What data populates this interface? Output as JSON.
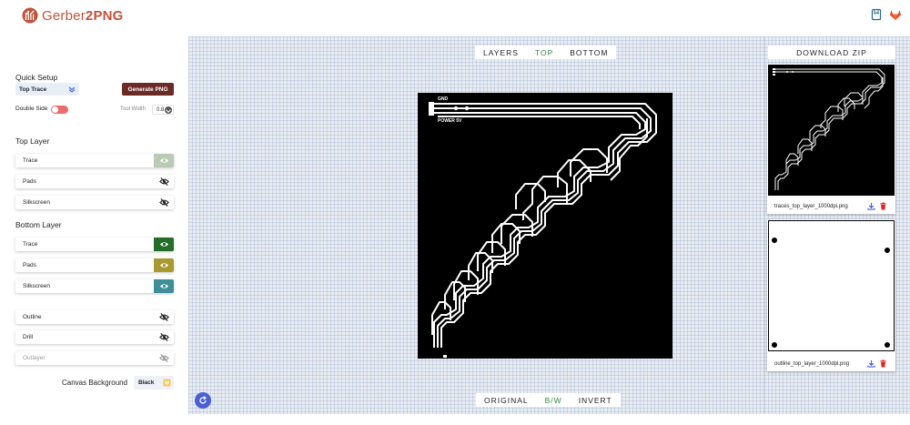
{
  "header": {
    "brand_prefix": "Gerber",
    "brand_number": "2",
    "brand_suffix": "PNG"
  },
  "sidebar": {
    "quick_setup": "Quick Setup",
    "preset_value": "Top Trace",
    "generate_label": "Generate PNG",
    "double_side_label": "Double Side",
    "double_side_on": false,
    "tool_width_label": "Tool Width",
    "tool_width_value": "0.8",
    "top_layer_title": "Top Layer",
    "top_layers": [
      {
        "label": "Trace",
        "visible": true,
        "color": "#b9cbb5"
      },
      {
        "label": "Pads",
        "visible": false,
        "color": "#ffffff"
      },
      {
        "label": "Silkscreen",
        "visible": false,
        "color": "#ffffff"
      }
    ],
    "bottom_layer_title": "Bottom Layer",
    "bottom_layers": [
      {
        "label": "Trace",
        "visible": true,
        "color": "#256e2a"
      },
      {
        "label": "Pads",
        "visible": true,
        "color": "#a99a2f"
      },
      {
        "label": "Silkscreen",
        "visible": true,
        "color": "#3f8f98"
      }
    ],
    "other_layers": [
      {
        "label": "Outline",
        "visible": false,
        "disabled": false
      },
      {
        "label": "Drill",
        "visible": false,
        "disabled": false
      },
      {
        "label": "Outlayer",
        "visible": false,
        "disabled": true
      }
    ],
    "canvas_bg_label": "Canvas Background",
    "canvas_bg_value": "Black"
  },
  "view_tabs": {
    "items": [
      "LAYERS",
      "TOP",
      "BOTTOM"
    ],
    "active": "TOP"
  },
  "mode_tabs": {
    "items": [
      "ORIGINAL",
      "B/W",
      "INVERT"
    ],
    "active": "B/W"
  },
  "board": {
    "label_gnd": "GND",
    "label_power": "POWER 5V"
  },
  "right": {
    "download_zip": "DOWNLOAD ZIP",
    "files": [
      {
        "name": "traces_top_layer_1000dpi.png"
      },
      {
        "name": "outline_top_layer_1000dpi.png"
      }
    ]
  },
  "colors": {
    "brand": "#c0533a",
    "active_tab": "#2e8b3e",
    "generate_btn": "#6a2a26",
    "toggle_off": "#ef6a6a",
    "refresh": "#4a5fd6",
    "download_icon": "#4a5fd6",
    "delete_icon": "#e02424"
  }
}
